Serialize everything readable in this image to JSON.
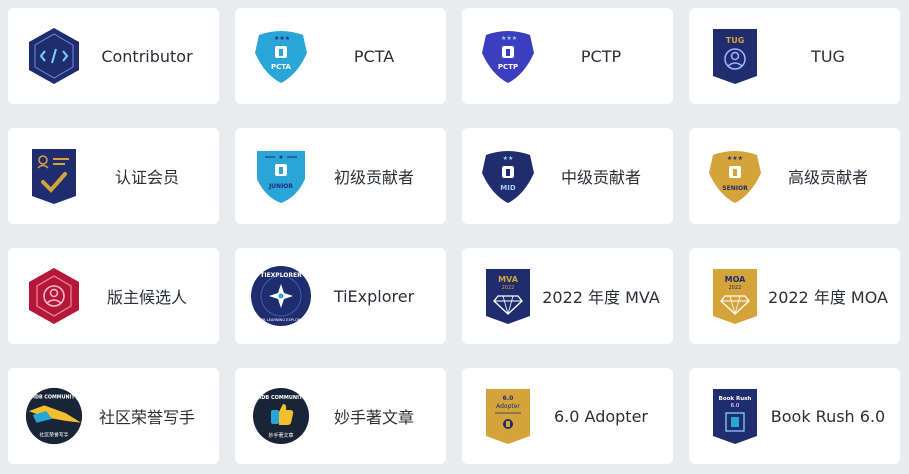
{
  "badges": [
    {
      "label": "Contributor"
    },
    {
      "label": "PCTA",
      "badge_text": "PCTA"
    },
    {
      "label": "PCTP",
      "badge_text": "PCTP"
    },
    {
      "label": "TUG",
      "badge_text": "TUG"
    },
    {
      "label": "认证会员"
    },
    {
      "label": "初级贡献者",
      "badge_text": "JUNIOR"
    },
    {
      "label": "中级贡献者",
      "badge_text": "MID"
    },
    {
      "label": "高级贡献者",
      "badge_text": "SENIOR"
    },
    {
      "label": "版主候选人"
    },
    {
      "label": "TiExplorer",
      "badge_text_top": "TIEXPLORER",
      "badge_text_bottom": "TIDB LEARNING EXPLORER"
    },
    {
      "label": "2022 年度 MVA",
      "badge_text": "MVA",
      "badge_year": "2022"
    },
    {
      "label": "2022 年度 MOA",
      "badge_text": "MOA",
      "badge_year": "2022"
    },
    {
      "label": "社区荣誉写手",
      "badge_text_top": "TIDB COMMUNITY",
      "badge_text_bottom": "社区荣誉写手"
    },
    {
      "label": "妙手著文章",
      "badge_text_top": "TIDB COMMUNITY",
      "badge_text_bottom": "妙手著文章"
    },
    {
      "label": "6.0 Adopter",
      "badge_text": "6.0",
      "badge_sub": "Adopter"
    },
    {
      "label": "Book Rush 6.0",
      "badge_text": "Book Rush",
      "badge_sub": "6.0"
    }
  ],
  "colors": {
    "navy": "#1f2d6e",
    "sky": "#2aa5d8",
    "indigo": "#3b3fbf",
    "gold": "#d4a33a",
    "crimson": "#b5173a",
    "page_bg": "#e9ebef",
    "text": "#2b2f36"
  }
}
